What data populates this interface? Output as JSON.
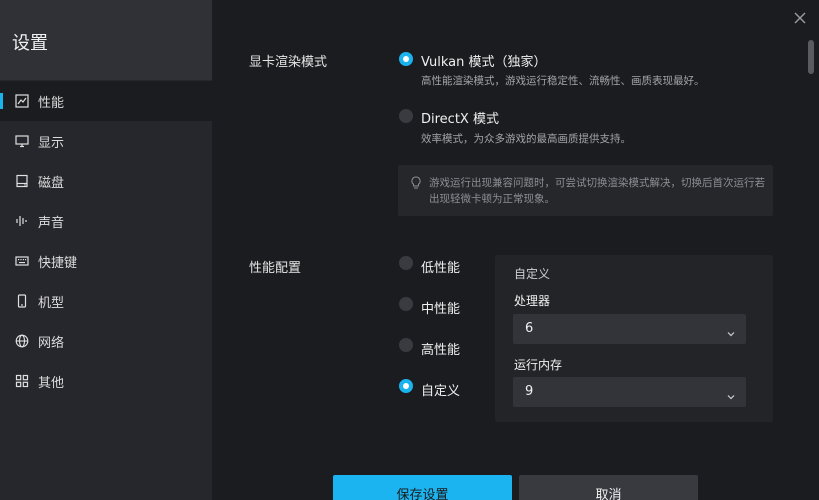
{
  "sidebar": {
    "title": "设置",
    "items": [
      {
        "label": "性能",
        "icon": "chart-line-icon"
      },
      {
        "label": "显示",
        "icon": "monitor-icon"
      },
      {
        "label": "磁盘",
        "icon": "disk-icon"
      },
      {
        "label": "声音",
        "icon": "sound-wave-icon"
      },
      {
        "label": "快捷键",
        "icon": "keyboard-icon"
      },
      {
        "label": "机型",
        "icon": "phone-icon"
      },
      {
        "label": "网络",
        "icon": "globe-icon"
      },
      {
        "label": "其他",
        "icon": "grid-icon"
      }
    ],
    "active": "性能"
  },
  "render_mode": {
    "label": "显卡渲染模式",
    "options": [
      {
        "label": "Vulkan 模式（独家）",
        "desc": "高性能渲染模式，游戏运行稳定性、流畅性、画质表现最好。",
        "selected": true
      },
      {
        "label": "DirectX 模式",
        "desc": "效率模式，为众多游戏的最高画质提供支持。",
        "selected": false
      }
    ],
    "tip": "游戏运行出现兼容问题时，可尝试切换渲染模式解决，切换后首次运行若出现轻微卡顿为正常现象。"
  },
  "performance": {
    "label": "性能配置",
    "options": [
      {
        "label": "低性能",
        "selected": false
      },
      {
        "label": "中性能",
        "selected": false
      },
      {
        "label": "高性能",
        "selected": false
      },
      {
        "label": "自定义",
        "selected": true
      }
    ],
    "custom": {
      "title": "自定义",
      "cpu_label": "处理器",
      "cpu_value": "6",
      "memory_label": "运行内存",
      "memory_value": "9"
    }
  },
  "actions": {
    "save": "保存设置",
    "cancel": "取消"
  },
  "colors": {
    "accent": "#1ab3ee",
    "background": "#1b1c20",
    "sidebar": "#26272c"
  }
}
